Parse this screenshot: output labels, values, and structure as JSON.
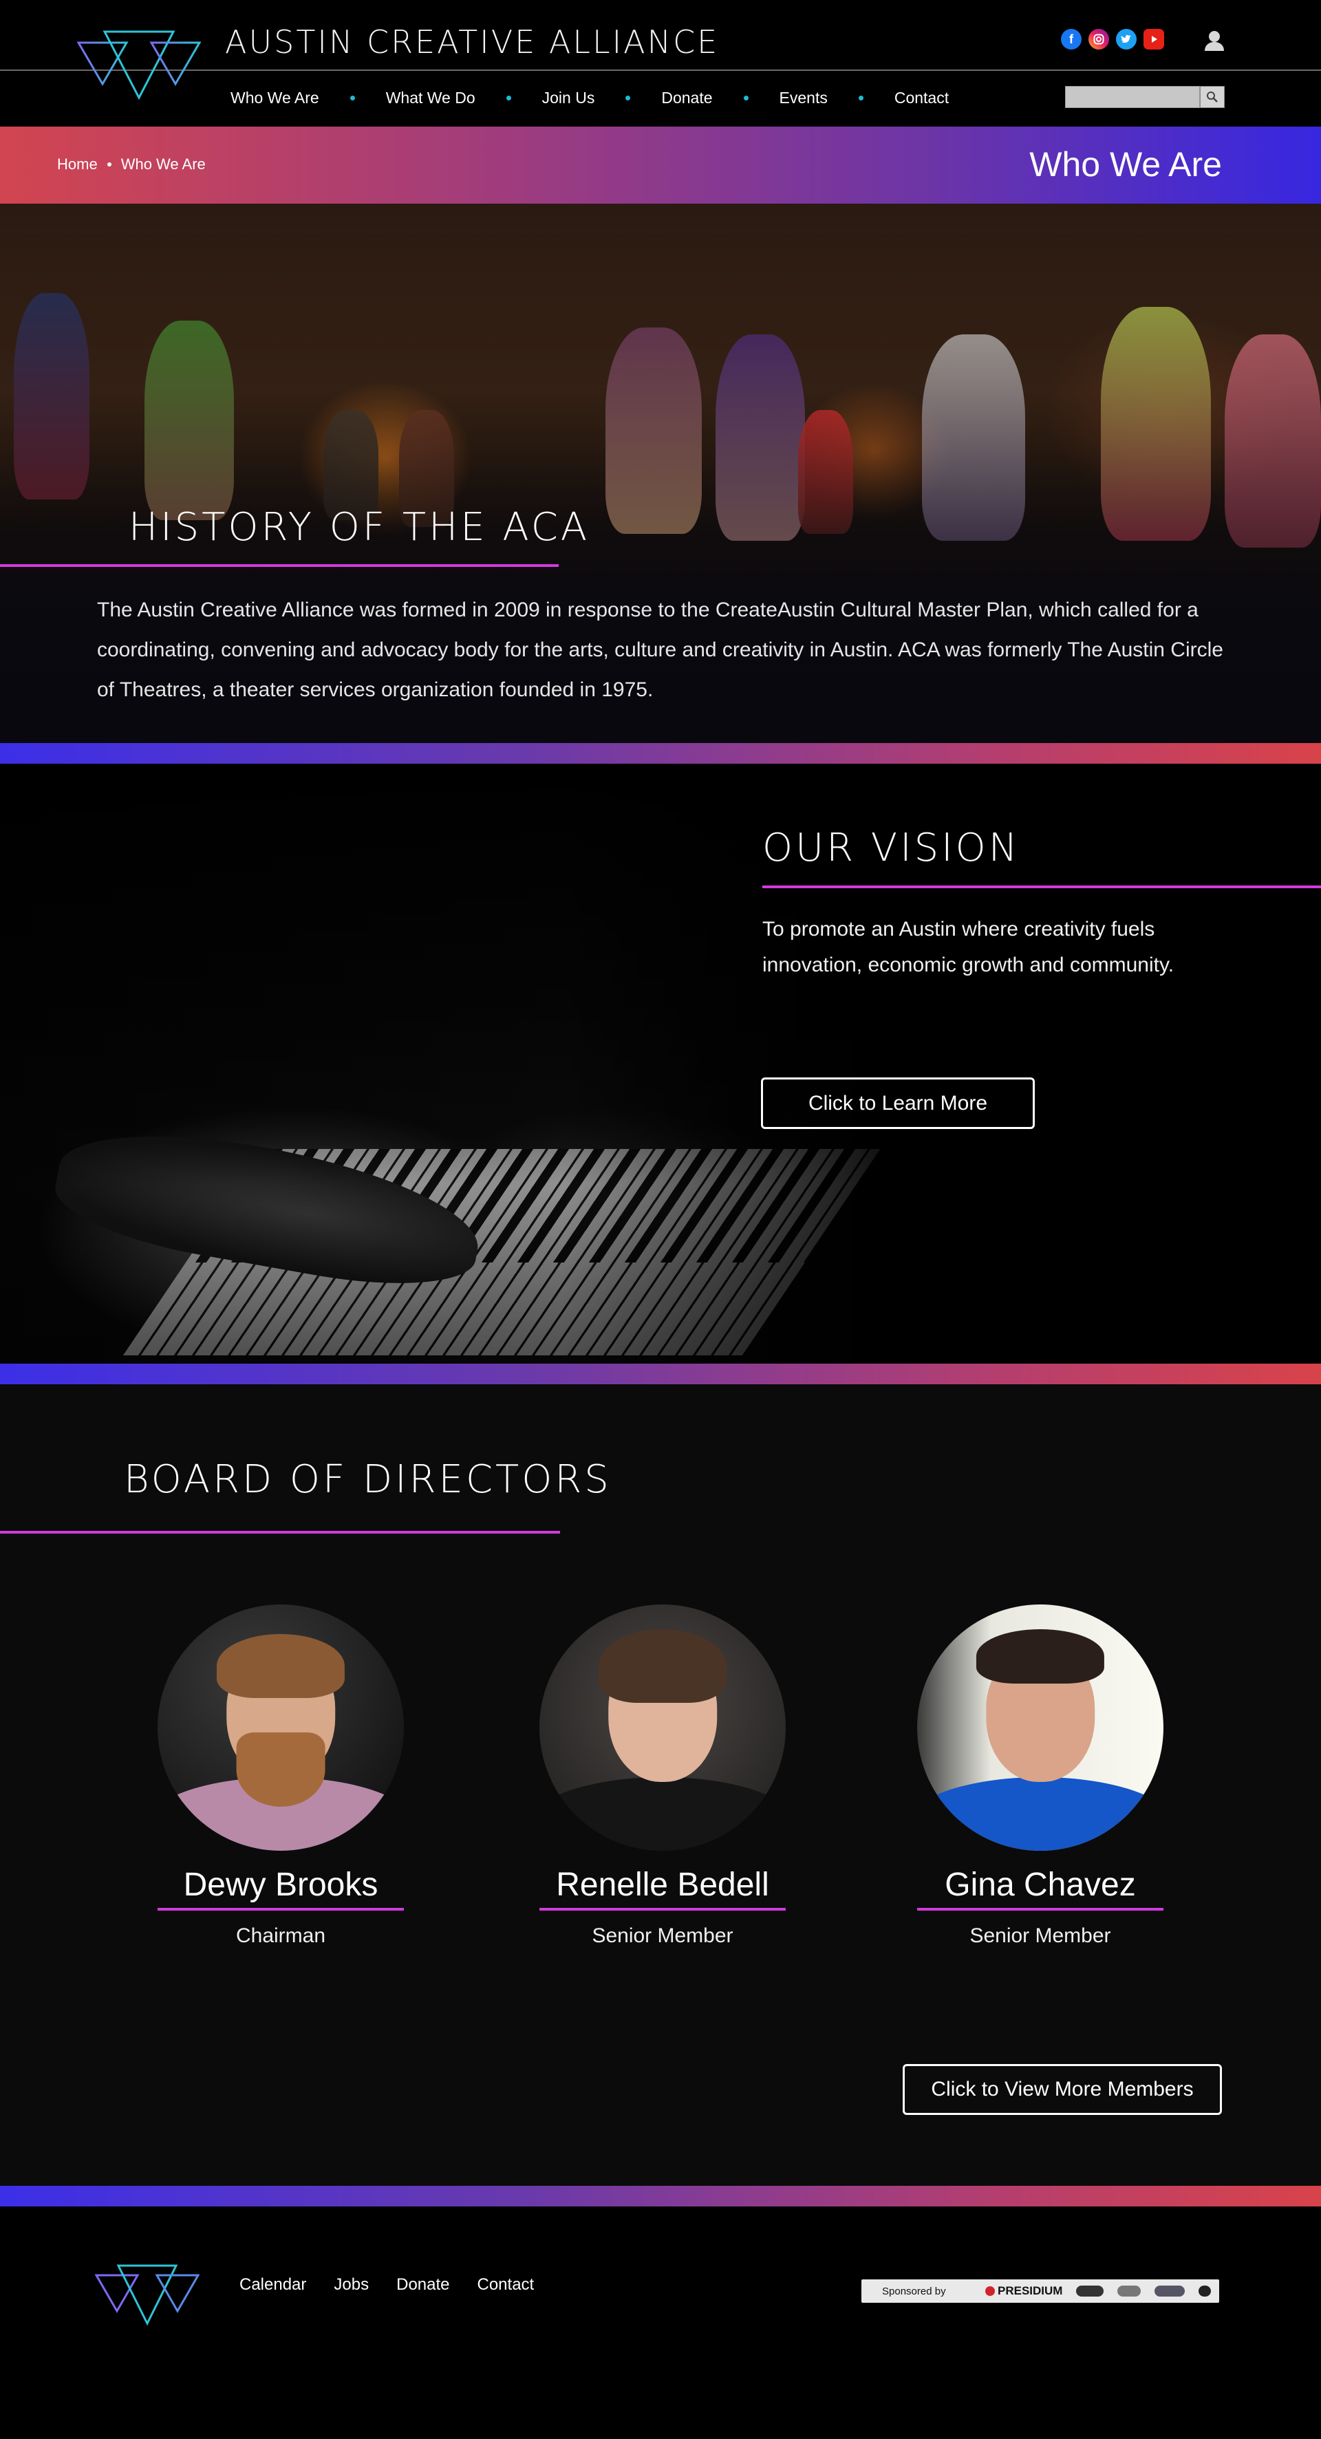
{
  "header": {
    "site_title": "AUSTIN CREATIVE ALLIANCE",
    "social_icons": [
      "facebook-icon",
      "instagram-icon",
      "twitter-icon",
      "youtube-icon"
    ],
    "user_icon": "user-icon",
    "nav": [
      "Who We Are",
      "What We Do",
      "Join Us",
      "Donate",
      "Events",
      "Contact"
    ],
    "search": {
      "placeholder": "",
      "button_icon": "search-icon"
    }
  },
  "banner": {
    "breadcrumbs": [
      "Home",
      "Who We Are"
    ],
    "title": "Who We Are"
  },
  "history": {
    "title": "HISTORY OF THE ACA",
    "text": "The Austin Creative Alliance was formed in 2009 in response to the CreateAustin Cultural Master Plan, which called for a coordinating, convening and advocacy body for the arts, culture and creativity in Austin. ACA was formerly The Austin Circle of Theatres, a theater services organization founded in 1975."
  },
  "vision": {
    "title": "OUR VISION",
    "text": "To promote an Austin where creativity fuels innovation, economic growth and community.",
    "button": "Click to Learn More"
  },
  "board": {
    "title": "BOARD OF DIRECTORS",
    "members": [
      {
        "name": "Dewy Brooks",
        "role": "Chairman"
      },
      {
        "name": "Renelle Bedell",
        "role": "Senior Member"
      },
      {
        "name": "Gina Chavez",
        "role": "Senior Member"
      }
    ],
    "button": "Click to View More Members"
  },
  "footer": {
    "links": [
      "Calendar",
      "Jobs",
      "Donate",
      "Contact"
    ],
    "sponsor_label": "Sponsored by",
    "sponsor_name": "PRESIDIUM"
  },
  "colors": {
    "accent_magenta": "#d13adf",
    "nav_dot_teal": "#1dbcd0",
    "gradient_red": "#d24550",
    "gradient_blue": "#3727e0"
  }
}
